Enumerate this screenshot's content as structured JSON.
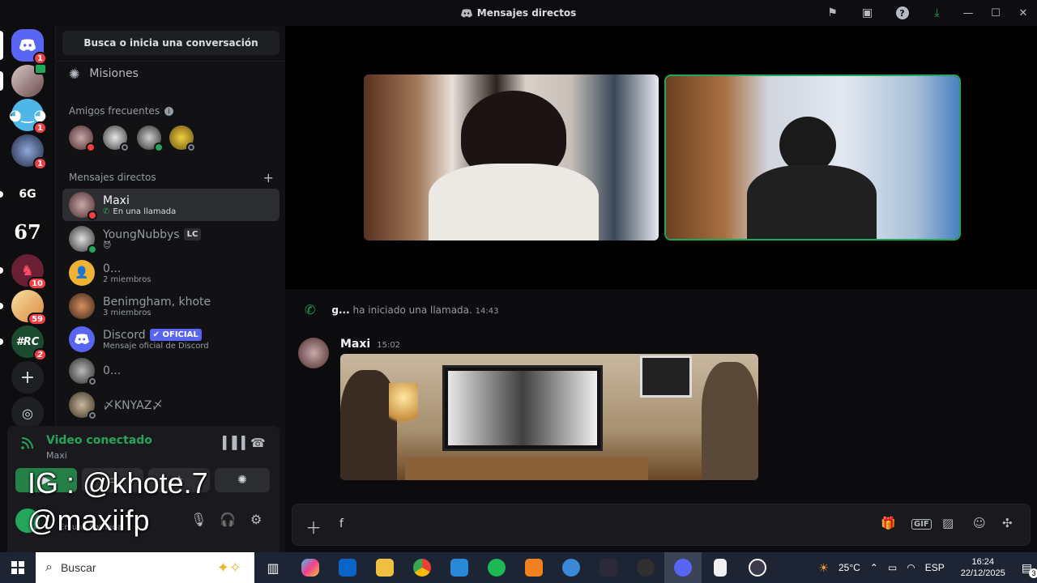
{
  "window": {
    "title": "Mensajes directos",
    "icons": [
      "flag-icon",
      "inbox-icon",
      "help-icon",
      "download-icon"
    ],
    "controls": [
      "minimize",
      "maximize",
      "close"
    ]
  },
  "servers": [
    {
      "name": "discord-home",
      "badge": "1",
      "color": "#5865f2"
    },
    {
      "name": "user-video",
      "badge": "",
      "color": "#8a6a6a"
    },
    {
      "name": "server-blue",
      "badge": "1",
      "color": "#4fb6e8"
    },
    {
      "name": "server-swirl",
      "badge": "1",
      "color": "#2d3a55"
    },
    {
      "name": "server-6g",
      "label": "6G",
      "badge": "",
      "color": "#0e0e10"
    },
    {
      "name": "server-67",
      "label": "67",
      "badge": "",
      "color": "#0e0e10"
    },
    {
      "name": "server-red",
      "badge": "10",
      "color": "#6a2034"
    },
    {
      "name": "server-game",
      "badge": "59",
      "color": "#e8c070"
    },
    {
      "name": "server-rc",
      "label": "#RC",
      "badge": "2",
      "color": "#1c4a2e"
    }
  ],
  "sidebar": {
    "search_label": "Busca o inicia una conversación",
    "missions_label": "Misiones",
    "frequent_friends_label": "Amigos frecuentes",
    "dm_label": "Mensajes directos",
    "dms": [
      {
        "name": "Maxi",
        "sub": "En una llamada",
        "tag": "",
        "status": "dnd",
        "active": true
      },
      {
        "name": "YoungNubbys",
        "sub": "😈",
        "tag": "LC",
        "status": "on",
        "active": false
      },
      {
        "name": "0...",
        "sub": "2 miembros",
        "tag": "",
        "status": "",
        "active": false
      },
      {
        "name": "Benimgham, khote",
        "sub": "3 miembros",
        "tag": "",
        "status": "",
        "active": false
      },
      {
        "name": "Discord",
        "sub": "Mensaje oficial de Discord",
        "tag": "✔ OFICIAL",
        "status": "",
        "active": false
      },
      {
        "name": "0...",
        "sub": "",
        "tag": "",
        "status": "off",
        "active": false
      },
      {
        "name": "〆KNYAZ〆",
        "sub": "",
        "tag": "",
        "status": "off",
        "active": false
      }
    ]
  },
  "voice": {
    "status": "Video conectado",
    "channel": "Maxi",
    "user_status": "En una llamada"
  },
  "overlay": {
    "line1": "IG : @khote.7",
    "line2": "@maxiifp"
  },
  "chat": {
    "system_author": "g...",
    "system_text": "ha iniciado una llamada.",
    "system_time": "14:43",
    "message_author": "Maxi",
    "message_time": "15:02",
    "composer_text": "f"
  },
  "taskbar": {
    "search_placeholder": "Buscar",
    "temperature": "25°C",
    "language": "ESP",
    "time": "16:24",
    "date": "22/12/2025",
    "weather_badge": "2",
    "notif_count": "3"
  },
  "colors": {
    "accent": "#5865f2",
    "online": "#23a55a",
    "dnd": "#f23f43"
  }
}
